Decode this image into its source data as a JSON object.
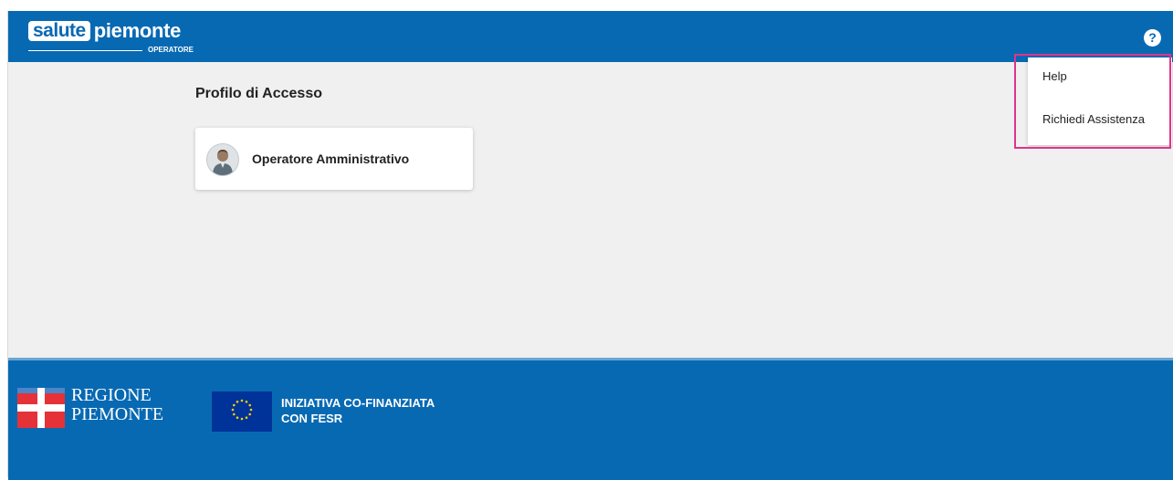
{
  "header": {
    "logo_box": "salute",
    "logo_main": "piemonte",
    "logo_sub": "OPERATORE",
    "help_icon": "question-circle-icon"
  },
  "main": {
    "title": "Profilo di Accesso",
    "profiles": [
      {
        "label": "Operatore Amministrativo",
        "icon": "user-avatar-icon"
      }
    ]
  },
  "help_menu": {
    "items": [
      "Help",
      "Richiedi Assistenza"
    ]
  },
  "footer": {
    "regione_line1": "REGIONE",
    "regione_line2": "PIEMONTE",
    "fesr_line1": "INIZIATIVA CO-FINANZIATA",
    "fesr_line2": "CON FESR"
  },
  "colors": {
    "brand_blue": "#0869b3",
    "highlight": "#e0338b",
    "regione_red": "#e53238"
  }
}
